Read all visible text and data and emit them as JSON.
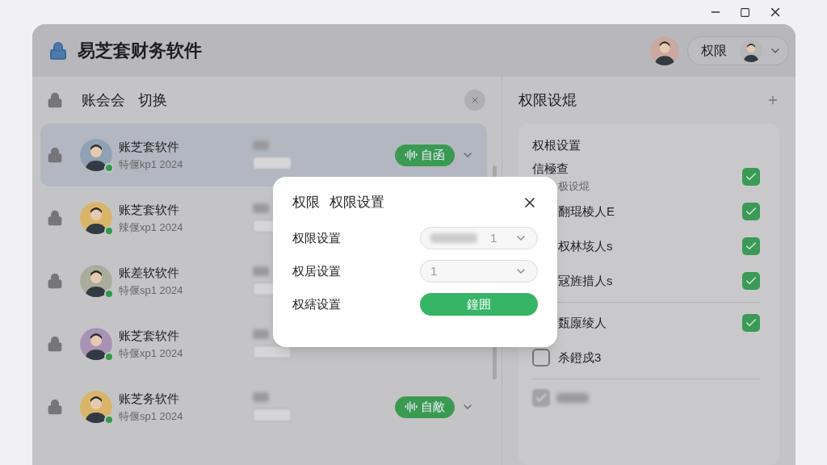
{
  "app": {
    "title": "易芝套财务软件",
    "role_menu": {
      "label": "权限"
    }
  },
  "accounts": {
    "title": "账会会",
    "switch_label": "切换",
    "rows": [
      {
        "name": "账芝套软件",
        "subtitle": "特偃kp1 2024",
        "selected": true,
        "online": true,
        "badge": "自函"
      },
      {
        "name": "账芝套软件",
        "subtitle": "辣偃xp1 2024",
        "selected": false,
        "online": true
      },
      {
        "name": "账差软软件",
        "subtitle": "特偃sp1 2024",
        "selected": false,
        "online": true
      },
      {
        "name": "账芝套软件",
        "subtitle": "特偃xp1 2024",
        "selected": false,
        "online": true
      },
      {
        "name": "账芝务软件",
        "subtitle": "特偃sp1 2024",
        "selected": false,
        "online": true,
        "badge": "自敵"
      }
    ]
  },
  "permissions": {
    "title": "权限设焜",
    "card_title": "权根设置",
    "items": [
      {
        "kind": "right",
        "label": "信極查",
        "sub": "极设焜",
        "checked": true
      },
      {
        "kind": "right",
        "label": "翻琨棱人E",
        "checked": true
      },
      {
        "kind": "right",
        "label": "权林垓人s",
        "checked": true
      },
      {
        "kind": "right",
        "label": "冦旌措人s",
        "checked": true,
        "divider_after": true
      },
      {
        "kind": "right",
        "label": "瓾厡绫人",
        "checked": true
      },
      {
        "kind": "left",
        "label": "杀鐙戍3",
        "checked": false,
        "divider_after": true
      },
      {
        "kind": "blurred",
        "checked": true
      }
    ]
  },
  "dialog": {
    "title": "权限",
    "subtitle": "权限设置",
    "rows": [
      {
        "kind": "select",
        "label": "权限设置",
        "value": "1"
      },
      {
        "kind": "select",
        "label": "权居设置",
        "value": "1"
      },
      {
        "kind": "button",
        "label": "权縖设置",
        "button": "鐘囲"
      }
    ]
  }
}
